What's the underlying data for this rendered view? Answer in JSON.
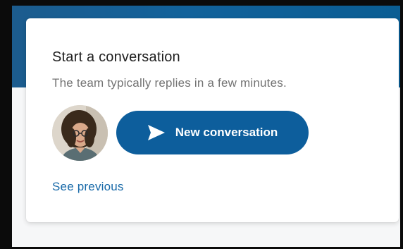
{
  "card": {
    "title": "Start a conversation",
    "subtitle": "The team typically replies in a few minutes.",
    "cta_label": "New conversation",
    "see_previous": "See previous"
  },
  "icons": {
    "cta": "paper-plane-send-icon"
  },
  "colors": {
    "header": "#12629b",
    "cta_background": "#0d5e9c",
    "link": "#1769a8"
  }
}
